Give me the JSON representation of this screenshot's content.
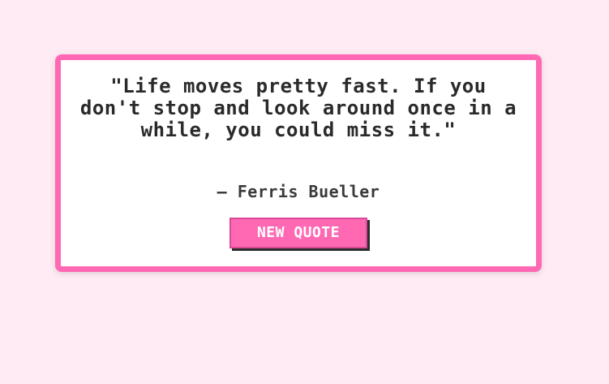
{
  "quote_card": {
    "quote": "\"Life moves pretty fast. If you don't stop and look around once in a while, you could miss it.\"",
    "author": "— Ferris Bueller",
    "new_quote_label": "NEW QUOTE"
  },
  "colors": {
    "background": "#ffebf3",
    "accent": "#ff69b4",
    "card": "#ffffff",
    "text": "#2a2a2a"
  }
}
